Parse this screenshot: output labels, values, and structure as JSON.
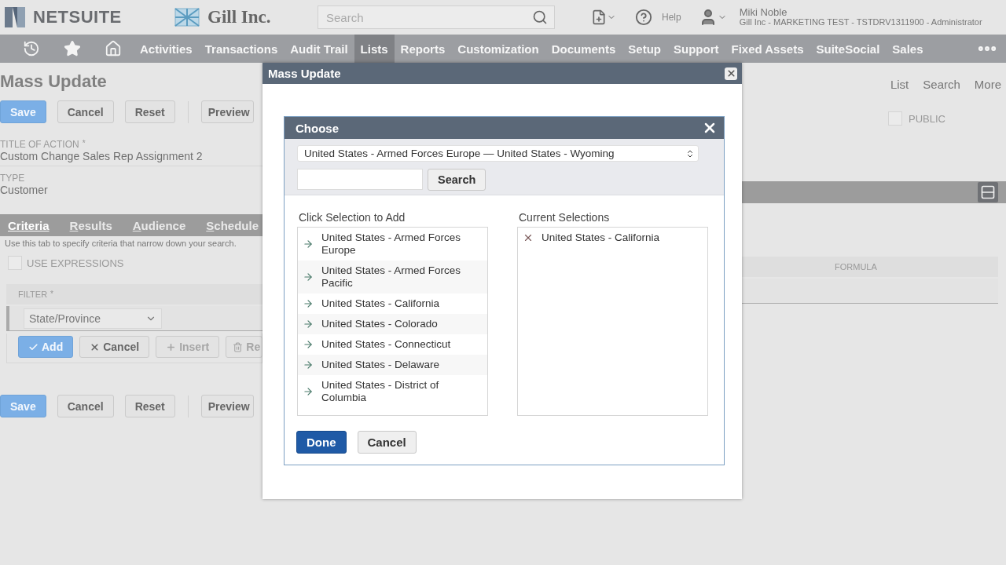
{
  "header": {
    "logo": "NETSUITE",
    "company": "Gill Inc.",
    "search": {
      "placeholder": "Search"
    },
    "help": "Help",
    "user": {
      "name": "Miki Noble",
      "account": "Gill Inc - MARKETING TEST - TSTDRV1311900 - Administrator"
    }
  },
  "nav": [
    {
      "label": "Activities",
      "selected": false
    },
    {
      "label": "Transactions",
      "selected": false
    },
    {
      "label": "Audit Trail",
      "selected": false
    },
    {
      "label": "Lists",
      "selected": true
    },
    {
      "label": "Reports",
      "selected": false
    },
    {
      "label": "Customization",
      "selected": false
    },
    {
      "label": "Documents",
      "selected": false
    },
    {
      "label": "Setup",
      "selected": false
    },
    {
      "label": "Support",
      "selected": false
    },
    {
      "label": "Fixed Assets",
      "selected": false
    },
    {
      "label": "SuiteSocial",
      "selected": false
    },
    {
      "label": "Sales",
      "selected": false
    }
  ],
  "page": {
    "title": "Mass Update",
    "links": [
      "List",
      "Search",
      "More"
    ],
    "buttons": [
      {
        "label": "Save",
        "kind": "primary"
      },
      {
        "label": "Cancel",
        "kind": "default"
      },
      {
        "label": "Reset",
        "kind": "default"
      },
      {
        "label": "Preview",
        "kind": "default"
      }
    ],
    "fields": [
      {
        "label": "TITLE OF ACTION",
        "required_mark": "*",
        "value": "Custom Change Sales Rep Assignment 2"
      },
      {
        "label": "TYPE",
        "value": "Customer"
      }
    ],
    "public": {
      "label": "PUBLIC",
      "checked": false
    },
    "tabs": [
      {
        "label": "Criteria",
        "selected": true
      },
      {
        "label": "Results",
        "selected": false
      },
      {
        "label": "Audience",
        "selected": false
      },
      {
        "label": "Schedule",
        "selected": false
      }
    ],
    "tab_hint": "Use this tab to specify criteria that narrow down your search.",
    "use_expressions": {
      "label": "USE EXPRESSIONS",
      "checked": false
    },
    "filter_table": {
      "columns": [
        {
          "label": "FILTER",
          "required_mark": "*"
        },
        {
          "label": "FORMULA"
        }
      ],
      "row": {
        "filter": "State/Province"
      },
      "buttons": [
        {
          "label": "Add",
          "kind": "primary",
          "disabled": false
        },
        {
          "label": "Cancel",
          "kind": "default",
          "disabled": false
        },
        {
          "label": "Insert",
          "kind": "default",
          "disabled": true
        },
        {
          "label": "Re",
          "kind": "default",
          "disabled": true
        }
      ]
    },
    "bottom_buttons": [
      {
        "label": "Save",
        "kind": "primary"
      },
      {
        "label": "Cancel",
        "kind": "default"
      },
      {
        "label": "Reset",
        "kind": "default"
      },
      {
        "label": "Preview",
        "kind": "default"
      }
    ]
  },
  "dialog": {
    "title": "Mass Update",
    "chooser": {
      "title": "Choose",
      "range": "United States - Armed Forces Europe — United States - Wyoming",
      "search_button": "Search",
      "available_label": "Click Selection to Add",
      "available": [
        "United States - Armed Forces Europe",
        "United States - Armed Forces Pacific",
        "United States - California",
        "United States - Colorado",
        "United States - Connecticut",
        "United States - Delaware",
        "United States - District of Columbia"
      ],
      "current_label": "Current Selections",
      "current": [
        "United States - California"
      ],
      "buttons": [
        {
          "label": "Done",
          "kind": "primary"
        },
        {
          "label": "Cancel",
          "kind": "default"
        }
      ]
    }
  }
}
